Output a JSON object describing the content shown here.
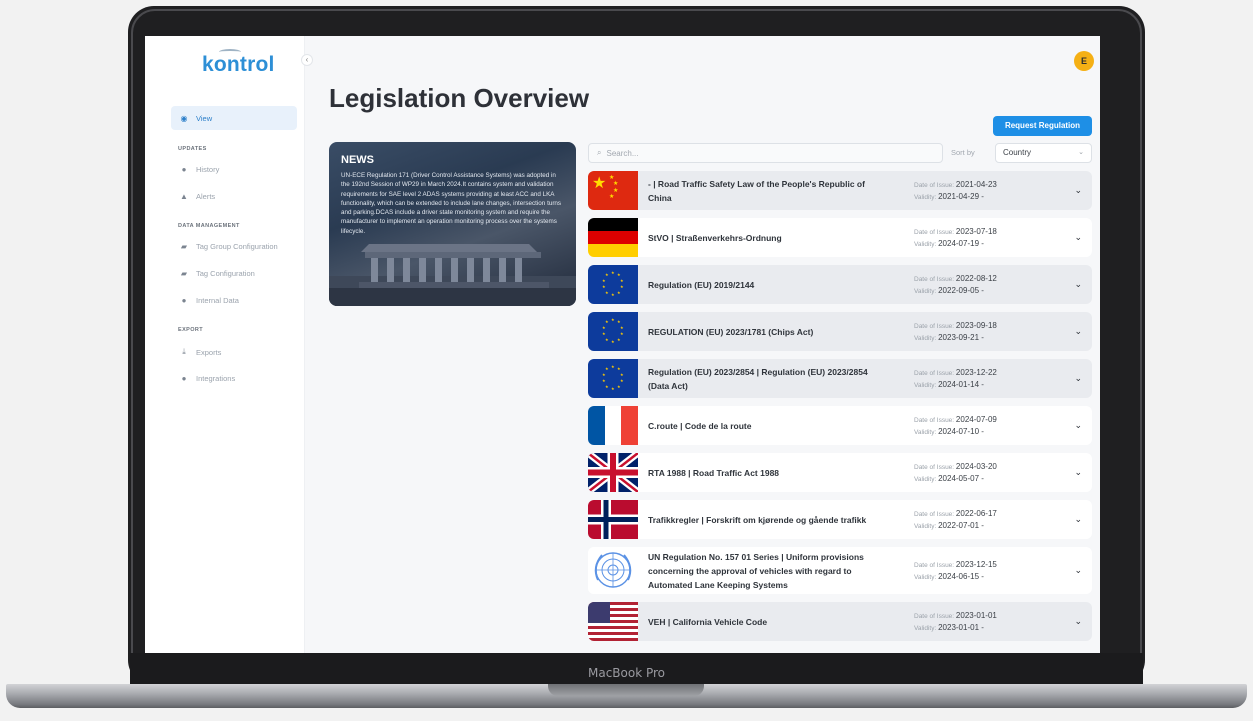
{
  "device": {
    "label": "MacBook Pro"
  },
  "app": {
    "logo": "kontrol",
    "avatar_initial": "E"
  },
  "sidebar": {
    "items": [
      {
        "label": "View",
        "icon": "eye-icon"
      }
    ],
    "sections": [
      {
        "title": "UPDATES",
        "items": [
          {
            "label": "History",
            "icon": "clock-icon"
          },
          {
            "label": "Alerts",
            "icon": "bell-icon"
          }
        ]
      },
      {
        "title": "DATA MANAGEMENT",
        "items": [
          {
            "label": "Tag Group Configuration",
            "icon": "tag-icon"
          },
          {
            "label": "Tag Configuration",
            "icon": "tag-icon"
          },
          {
            "label": "Internal Data",
            "icon": "database-icon"
          }
        ]
      },
      {
        "title": "EXPORT",
        "items": [
          {
            "label": "Exports",
            "icon": "download-icon"
          },
          {
            "label": "Integrations",
            "icon": "plug-icon"
          }
        ]
      }
    ]
  },
  "main": {
    "title": "Legislation Overview",
    "request_button": "Request Regulation",
    "search_placeholder": "Search...",
    "sort_label": "Sort by",
    "sort_value": "Country",
    "date_issue_label": "Date of Issue:",
    "validity_label": "Validity:"
  },
  "news": {
    "title": "NEWS",
    "body": "UN-ECE Regulation 171 (Driver Control Assistance Systems) was adopted in the 192nd Session of WP29 in March 2024.It contains system and validation requirements for SAE level 2 ADAS systems providing at least ACC and LKA functionality, which can be extended to include lane changes, intersection turns and parking.DCAS include a driver state monitoring system and require the manufacturer to implement an operation monitoring process over the systems lifecycle."
  },
  "regulations": [
    {
      "title": "- | Road Traffic Safety Law of the People's Republic of China",
      "issue": "2021-04-23",
      "validity": "2021-04-29 -",
      "flag": "china",
      "shaded": true
    },
    {
      "title": "StVO | Straßenverkehrs-Ordnung",
      "issue": "2023-07-18",
      "validity": "2024-07-19 -",
      "flag": "germany",
      "shaded": false
    },
    {
      "title": "Regulation (EU) 2019/2144",
      "issue": "2022-08-12",
      "validity": "2022-09-05 -",
      "flag": "eu",
      "shaded": true
    },
    {
      "title": "REGULATION (EU) 2023/1781 (Chips Act)",
      "issue": "2023-09-18",
      "validity": "2023-09-21 -",
      "flag": "eu",
      "shaded": true
    },
    {
      "title": "Regulation (EU) 2023/2854 | Regulation (EU) 2023/2854 (Data Act)",
      "issue": "2023-12-22",
      "validity": "2024-01-14 -",
      "flag": "eu",
      "shaded": true
    },
    {
      "title": "C.route | Code de la route",
      "issue": "2024-07-09",
      "validity": "2024-07-10 -",
      "flag": "france",
      "shaded": false
    },
    {
      "title": "RTA 1988 | Road Traffic Act 1988",
      "issue": "2024-03-20",
      "validity": "2024-05-07 -",
      "flag": "uk",
      "shaded": false
    },
    {
      "title": "Trafikkregler | Forskrift om kjørende og gående trafikk",
      "issue": "2022-06-17",
      "validity": "2022-07-01 -",
      "flag": "norway",
      "shaded": false
    },
    {
      "title": "UN Regulation No. 157 01 Series | Uniform provisions concerning the approval of vehicles with regard to Automated Lane Keeping Systems",
      "issue": "2023-12-15",
      "validity": "2024-06-15 -",
      "flag": "un",
      "shaded": false
    },
    {
      "title": "VEH | California Vehicle Code",
      "issue": "2023-01-01",
      "validity": "2023-01-01 -",
      "flag": "usa",
      "shaded": true
    }
  ]
}
